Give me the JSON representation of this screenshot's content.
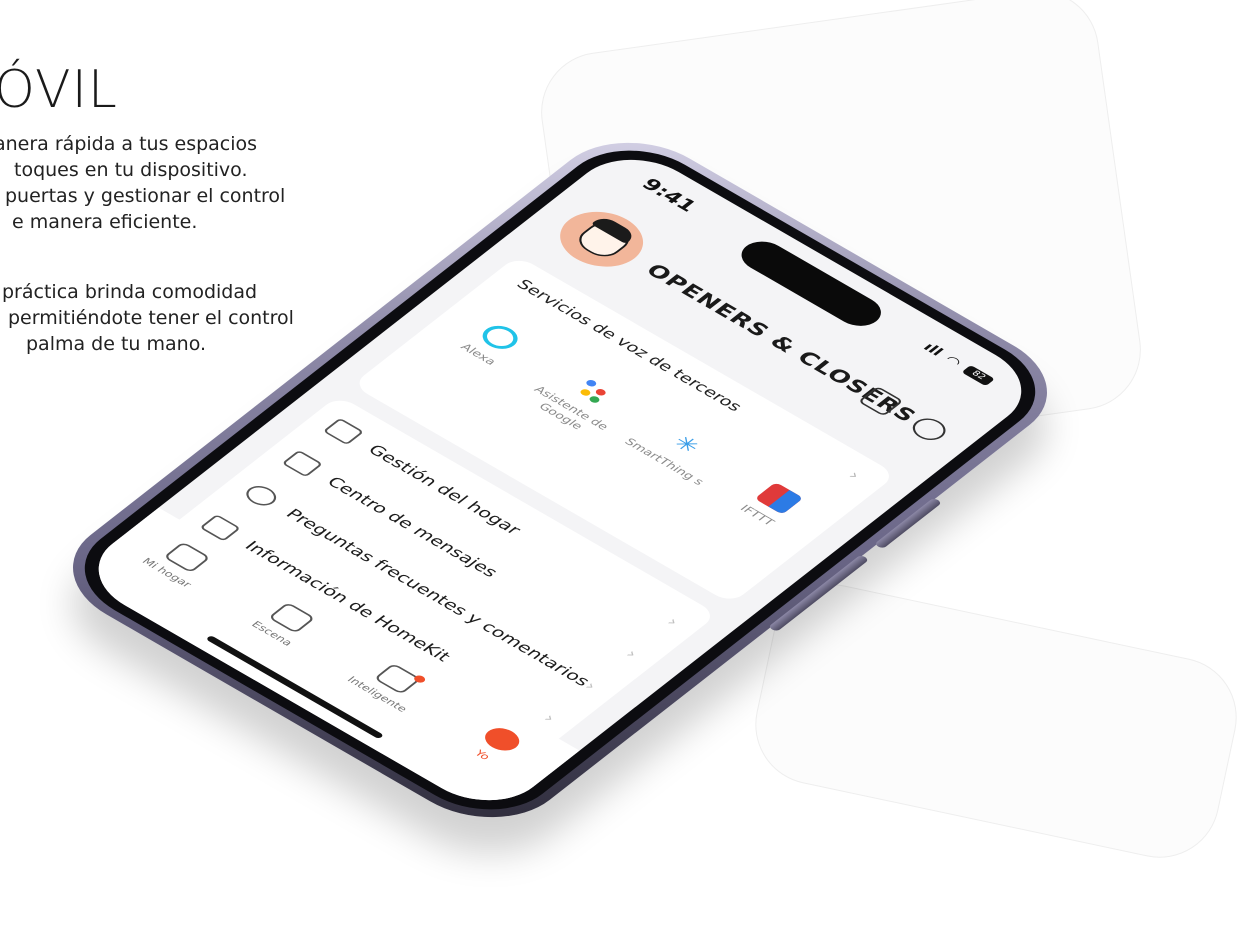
{
  "headline": "ÓVIL",
  "paragraph1": [
    "anera rápida a tus espacios",
    "toques en tu dispositivo.",
    "puertas y gestionar el control",
    "e manera eficiente."
  ],
  "paragraph2": [
    "práctica brinda comodidad",
    "permitiéndote tener el control",
    "palma de tu mano."
  ],
  "phone": {
    "time": "9:41",
    "battery": "82",
    "brand": "OPENERS & CLOSERS",
    "voice_title": "Servicios de voz de terceros",
    "services": [
      {
        "label": "Alexa"
      },
      {
        "label": "Asistente de Google"
      },
      {
        "label": "SmartThing s"
      },
      {
        "label": "IFTTT"
      }
    ],
    "menu": [
      {
        "label": "Gestión del hogar"
      },
      {
        "label": "Centro de mensajes"
      },
      {
        "label": "Preguntas frecuentes y comentarios"
      },
      {
        "label": "Información de HomeKit"
      }
    ],
    "tabs": [
      {
        "label": "Mi hogar"
      },
      {
        "label": "Escena"
      },
      {
        "label": "Inteligente"
      },
      {
        "label": "Yo"
      }
    ],
    "chevron": "›"
  },
  "colors": {
    "accent": "#f04f2a",
    "alexa": "#20c3e8",
    "frame": "#8e8aa8"
  }
}
